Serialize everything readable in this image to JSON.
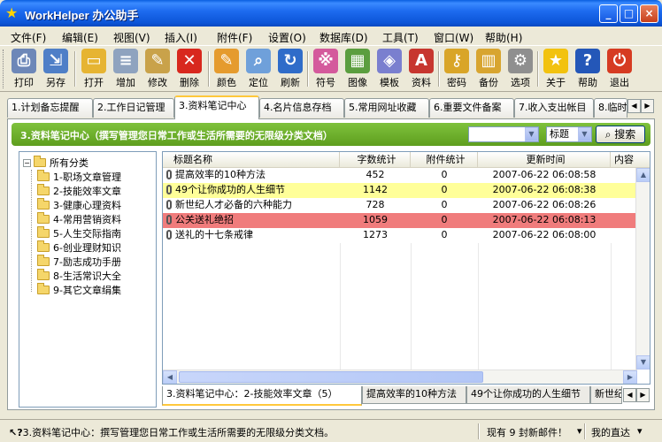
{
  "window": {
    "title": "WorkHelper 办公助手",
    "controls": {
      "minimize": "_",
      "maximize": "□",
      "close": "×"
    }
  },
  "menu": [
    "文件(F)",
    "编辑(E)",
    "视图(V)",
    "插入(I)",
    "附件(F)",
    "设置(O)",
    "数据库(D)",
    "工具(T)",
    "窗口(W)",
    "帮助(H)"
  ],
  "toolbar": [
    {
      "label": "打印",
      "icon": "printer-icon",
      "color": "#6D87B8",
      "glyph": "⎙"
    },
    {
      "label": "另存",
      "icon": "save-as-icon",
      "color": "#4F7FC7",
      "glyph": "⇲"
    },
    {
      "label": "打开",
      "icon": "open-folder-icon",
      "color": "#E6B432",
      "glyph": "▭"
    },
    {
      "label": "增加",
      "icon": "new-document-icon",
      "color": "#8FA3BF",
      "glyph": "≡"
    },
    {
      "label": "修改",
      "icon": "edit-document-icon",
      "color": "#C9A24A",
      "glyph": "✎"
    },
    {
      "label": "删除",
      "icon": "delete-icon",
      "color": "#D8281E",
      "glyph": "✕"
    },
    {
      "label": "颜色",
      "icon": "color-palette-icon",
      "color": "#E59B2E",
      "glyph": "✎"
    },
    {
      "label": "定位",
      "icon": "magnifier-icon",
      "color": "#6FA0DA",
      "glyph": "⌕"
    },
    {
      "label": "刷新",
      "icon": "refresh-icon",
      "color": "#2F6CC9",
      "glyph": "↻"
    },
    {
      "label": "符号",
      "icon": "symbols-icon",
      "color": "#D45A9C",
      "glyph": "※"
    },
    {
      "label": "图像",
      "icon": "image-icon",
      "color": "#5B9E3F",
      "glyph": "▦"
    },
    {
      "label": "模板",
      "icon": "template-icon",
      "color": "#7A7FCF",
      "glyph": "◈"
    },
    {
      "label": "资料",
      "icon": "document-a-icon",
      "color": "#C7362F",
      "glyph": "A"
    },
    {
      "label": "密码",
      "icon": "key-icon",
      "color": "#D9A528",
      "glyph": "⚷"
    },
    {
      "label": "备份",
      "icon": "backup-icon",
      "color": "#D8A530",
      "glyph": "▥"
    },
    {
      "label": "选项",
      "icon": "options-icon",
      "color": "#8F8F8F",
      "glyph": "⚙"
    },
    {
      "label": "关于",
      "icon": "star-icon",
      "color": "#F2C20F",
      "glyph": "★"
    },
    {
      "label": "帮助",
      "icon": "help-icon",
      "color": "#2457B8",
      "glyph": "?"
    },
    {
      "label": "退出",
      "icon": "power-icon",
      "color": "#D63B22",
      "glyph": "⏻"
    }
  ],
  "tabs": [
    "1.计划备忘提醒",
    "2.工作日记管理",
    "3.资料笔记中心",
    "4.名片信息存档",
    "5.常用网址收藏",
    "6.重要文件备案",
    "7.收入支出帐目",
    "8.临时"
  ],
  "banner": "3.资料笔记中心（撰写管理您日常工作或生活所需要的无限级分类文档）",
  "search": {
    "field": "标题",
    "button": "搜索",
    "value": ""
  },
  "tree": {
    "root": "所有分类",
    "items": [
      "1-职场文章管理",
      "2-技能效率文章",
      "3-健康心理资料",
      "4-常用营销资料",
      "5-人生交际指南",
      "6-创业理财知识",
      "7-励志成功手册",
      "8-生活常识大全",
      "9-其它文章绢集"
    ]
  },
  "grid": {
    "columns": [
      "标题名称",
      "字数统计",
      "附件统计",
      "更新时间",
      "内容"
    ],
    "rows": [
      {
        "title": "提高效率的10种方法",
        "words": "452",
        "attachments": "0",
        "updated": "2007-06-22 06:08:58",
        "highlight": "#FFFFFF"
      },
      {
        "title": "49个让你成功的人生细节",
        "words": "1142",
        "attachments": "0",
        "updated": "2007-06-22 06:08:38",
        "highlight": "#FFFF99"
      },
      {
        "title": "新世纪人才必备的六种能力",
        "words": "728",
        "attachments": "0",
        "updated": "2007-06-22 06:08:26",
        "highlight": "#FFFFFF"
      },
      {
        "title": "公关送礼绝招",
        "words": "1059",
        "attachments": "0",
        "updated": "2007-06-22 06:08:13",
        "highlight": "#F07C7C"
      },
      {
        "title": "送礼的十七条戒律",
        "words": "1273",
        "attachments": "0",
        "updated": "2007-06-22 06:08:00",
        "highlight": "#FFFFFF"
      }
    ]
  },
  "bottom_tabs": [
    "3.资料笔记中心：2-技能效率文章（5）",
    "提高效率的10种方法",
    "49个让你成功的人生细节",
    "新世纪"
  ],
  "status": {
    "message": "3.资料笔记中心：撰写管理您日常工作或生活所需要的无限级分类文档。",
    "mail": "现有 9 封新邮件！",
    "quick": "我的直达"
  }
}
